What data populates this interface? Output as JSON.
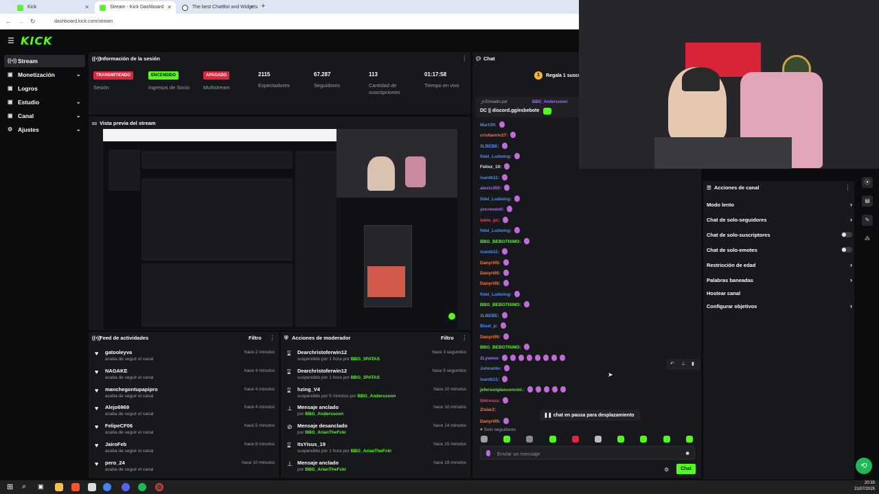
{
  "browser": {
    "tabs": [
      {
        "label": "Kick",
        "active": false
      },
      {
        "label": "Stream - Kick Dashboard",
        "active": true
      },
      {
        "label": "The best ChatBot and Widgets",
        "active": false
      }
    ],
    "url": "dashboard.kick.com/stream"
  },
  "app": {
    "logo": "KICK"
  },
  "sidebar": {
    "items": [
      {
        "label": "Stream",
        "icon": "broadcast-icon"
      },
      {
        "label": "Monetización",
        "icon": "money-icon"
      },
      {
        "label": "Logros",
        "icon": "trophy-icon"
      },
      {
        "label": "Estudio",
        "icon": "studio-icon"
      },
      {
        "label": "Canal",
        "icon": "channel-icon"
      },
      {
        "label": "Ajustes",
        "icon": "gear-icon"
      }
    ]
  },
  "session": {
    "title": "Información de la sesión",
    "stats": [
      {
        "badge": "TRANSMITIENDO",
        "label": "Sesión"
      },
      {
        "badge": "ENCENDIDO",
        "label": "Ingresos de Socio"
      },
      {
        "badge": "APAGADO",
        "label": "Multistream"
      },
      {
        "value": "2115",
        "label": "Espectadores"
      },
      {
        "value": "67.287",
        "label": "Seguidores"
      },
      {
        "value": "113",
        "label": "Cantidad de suscripciones"
      },
      {
        "value": "01:17:58",
        "label": "Tiempo en vivo"
      }
    ]
  },
  "preview": {
    "title": "Vista previa del stream"
  },
  "activity": {
    "title": "Feed de actividades",
    "filter": "Filtro",
    "items": [
      {
        "name": "gatooleyva",
        "sub": "acaba de seguir el canal",
        "time": "hace 2 minutos"
      },
      {
        "name": "NAGAKE",
        "sub": "acaba de seguir el canal",
        "time": "hace 4 minutos"
      },
      {
        "name": "manchegontupapipro",
        "sub": "acaba de seguir el canal",
        "time": "hace 4 minutos"
      },
      {
        "name": "Alejo6969",
        "sub": "acaba de seguir el canal",
        "time": "hace 4 minutos"
      },
      {
        "name": "FelipeCF06",
        "sub": "acaba de seguir el canal",
        "time": "hace 5 minutos"
      },
      {
        "name": "JairoFeb",
        "sub": "acaba de seguir el canal",
        "time": "hace 8 minutos"
      },
      {
        "name": "pero_24",
        "sub": "acaba de seguir el canal",
        "time": "hace 10 minutos"
      }
    ]
  },
  "moderator": {
    "title": "Acciones de moderador",
    "filter": "Filtro",
    "items": [
      {
        "name": "Dearchristoferwin12",
        "sub": "suspendido por 1 hora por",
        "by": "BBG_3PATAS",
        "time": "hace 3 segundos",
        "icon": "hourglass-icon"
      },
      {
        "name": "Dearchristoferwin12",
        "sub": "suspendido por 1 hora por",
        "by": "BBG_3PATAS",
        "time": "hace 5 segundos",
        "icon": "hourglass-icon"
      },
      {
        "name": "hzing_V4",
        "sub": "suspendido por 5 minutos por",
        "by": "BBG_Anderssoon",
        "time": "hace 10 minutos",
        "icon": "hourglass-icon"
      },
      {
        "name": "Mensaje anclado",
        "sub": "por",
        "by": "BBG_Anderssoon",
        "time": "hace 10 minutos",
        "icon": "pin-icon"
      },
      {
        "name": "Mensaje desanclado",
        "sub": "por",
        "by": "BBG_ArianTheFckr",
        "time": "hace 14 minutos",
        "icon": "unpin-icon"
      },
      {
        "name": "ItsYisus_19",
        "sub": "suspendido por 1 hora por",
        "by": "BBG_ArianTheFckr",
        "time": "hace 15 minutos",
        "icon": "hourglass-icon"
      },
      {
        "name": "Mensaje anclado",
        "sub": "por",
        "by": "BBG_ArianTheFckr",
        "time": "hace 19 minutos",
        "icon": "pin-icon"
      }
    ]
  },
  "chat": {
    "title": "Chat",
    "gift_banner": "Regala 1 suscri",
    "pinned_by_label": "Enviado por",
    "pinned_by_user": "BBG_Anderssoon",
    "pinned_text": "DC || discord.gg/esbebote",
    "messages": [
      {
        "user": "Mart3ft:",
        "color": "#4a90ff",
        "emotes": 1
      },
      {
        "user": "cristianriv27:",
        "color": "#ff7a3d",
        "emotes": 1
      },
      {
        "user": "3LBEBE:",
        "color": "#4a90ff",
        "emotes": 1
      },
      {
        "user": "fidel_Ludwing:",
        "color": "#4a90ff",
        "emotes": 1
      },
      {
        "user": "Felixx_10:",
        "color": "#e6e6e6",
        "emotes": 1
      },
      {
        "user": "ivantb11:",
        "color": "#4a90ff",
        "emotes": 1
      },
      {
        "user": "alexis350:",
        "color": "#a86bff",
        "emotes": 1
      },
      {
        "user": "fidel_Ludwing:",
        "color": "#4a90ff",
        "emotes": 1
      },
      {
        "user": "yocreoenti:",
        "color": "#a86bff",
        "emotes": 1
      },
      {
        "user": "tokio_pc:",
        "color": "#ff3b6b",
        "emotes": 1
      },
      {
        "user": "fidel_Ludwing:",
        "color": "#4a90ff",
        "emotes": 1
      },
      {
        "user": "BBG_BEBOTISMO:",
        "color": "#53fc18",
        "emotes": 1
      },
      {
        "user": "ivantb11:",
        "color": "#4a90ff",
        "emotes": 1
      },
      {
        "user": "Danyri05:",
        "color": "#ff7a3d",
        "emotes": 1
      },
      {
        "user": "Danyri05:",
        "color": "#ff7a3d",
        "emotes": 1
      },
      {
        "user": "Danyri05:",
        "color": "#ff7a3d",
        "emotes": 1
      },
      {
        "user": "fidel_Ludwing:",
        "color": "#4a90ff",
        "emotes": 1
      },
      {
        "user": "BBG_BEBOTISMO:",
        "color": "#53fc18",
        "emotes": 1
      },
      {
        "user": "3LBEBE:",
        "color": "#4a90ff",
        "emotes": 1
      },
      {
        "user": "Bluel_p:",
        "color": "#4a90ff",
        "emotes": 1
      },
      {
        "user": "Danyri05:",
        "color": "#ff7a3d",
        "emotes": 1
      },
      {
        "user": "BBG_BEBOTISMO:",
        "color": "#53fc18",
        "emotes": 1
      },
      {
        "user": "2Lywww:",
        "color": "#a86bff",
        "emotes": 8
      },
      {
        "user": "Johnat4n:",
        "color": "#4a90ff",
        "emotes": 1
      },
      {
        "user": "ivantb11:",
        "color": "#4a90ff",
        "emotes": 1
      },
      {
        "user": "jefersonplascenciol.:",
        "color": "#53fc18",
        "emotes": 5
      },
      {
        "user": "tlidrvoss:",
        "color": "#ff3b6b",
        "emotes": 1
      },
      {
        "user": "ZislarZ:",
        "color": "#ff7a3d",
        "emotes": 0
      },
      {
        "user": "Danyri05:",
        "color": "#ff7a3d",
        "emotes": 1
      }
    ],
    "paused_label": "chat en pausa para desplazamiento",
    "followers_only": "Solo seguidores",
    "input_placeholder": "Enviar un mensaje",
    "send_label": "Chat"
  },
  "channel_actions": {
    "title": "Acciones de canal",
    "items": [
      {
        "label": "Modo lento",
        "control": "chevron"
      },
      {
        "label": "Chat de solo-seguidores",
        "control": "chevron"
      },
      {
        "label": "Chat de solo-suscriptores",
        "control": "toggle"
      },
      {
        "label": "Chat de solo-emotes",
        "control": "toggle"
      },
      {
        "label": "Restricción de edad",
        "control": "chevron"
      },
      {
        "label": "Palabras baneadas",
        "control": "chevron"
      },
      {
        "label": "Hostear canal",
        "control": "none"
      },
      {
        "label": "Configurar objetivos",
        "control": "chevron"
      }
    ]
  },
  "taskbar": {
    "time": "20:33",
    "date": "21/07/2025"
  },
  "colors": {
    "kick_green": "#53fc18",
    "live_red": "#e0263d",
    "panel": "#17181c",
    "background": "#0b0c0e"
  }
}
